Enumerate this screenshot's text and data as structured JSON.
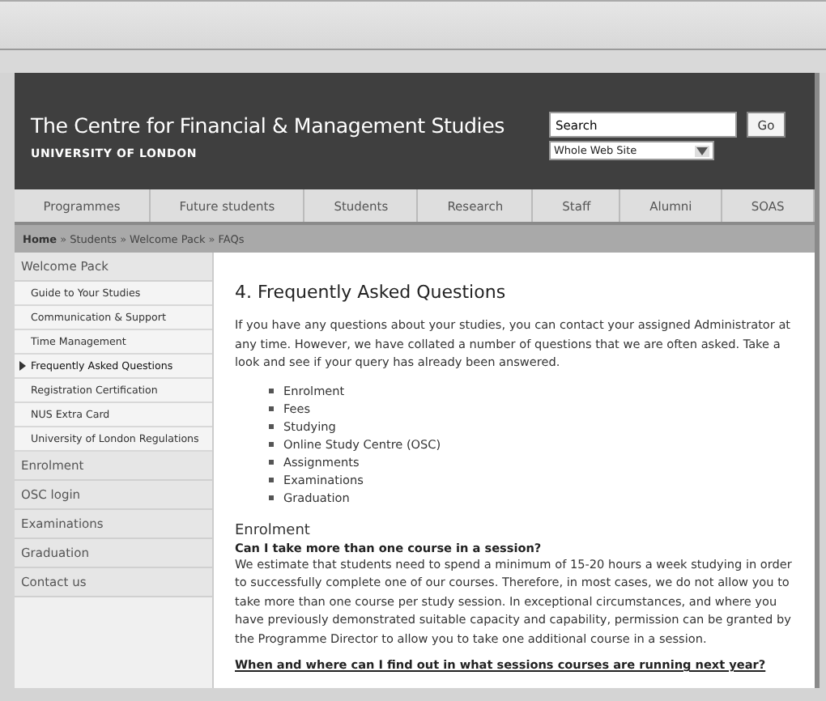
{
  "header": {
    "title": "The Centre for Financial & Management Studies",
    "subtitle": "UNIVERSITY OF LONDON",
    "search": {
      "value": "Search",
      "button": "Go",
      "scope": "Whole Web Site"
    }
  },
  "nav": [
    {
      "label": "Programmes",
      "selected": false
    },
    {
      "label": "Future students",
      "selected": false
    },
    {
      "label": "Students",
      "selected": false
    },
    {
      "label": "Research",
      "selected": false
    },
    {
      "label": "Staff",
      "selected": false
    },
    {
      "label": "Alumni",
      "selected": false
    },
    {
      "label": "SOAS",
      "selected": false
    }
  ],
  "breadcrumb": [
    {
      "label": "Home"
    },
    {
      "label": "Students"
    },
    {
      "label": "Welcome Pack"
    },
    {
      "label": "FAQs"
    }
  ],
  "breadcrumb_separator": "»",
  "sidebar": {
    "items": [
      {
        "label": "Welcome Pack",
        "selected": false,
        "children": [
          {
            "label": "Guide to Your Studies",
            "selected": false
          },
          {
            "label": "Communication & Support",
            "selected": false
          },
          {
            "label": "Time Management",
            "selected": false
          },
          {
            "label": "Frequently Asked Questions",
            "selected": true
          },
          {
            "label": "Registration Certification",
            "selected": false
          },
          {
            "label": "NUS Extra Card",
            "selected": false
          },
          {
            "label": "University of London Regulations",
            "selected": false
          }
        ]
      },
      {
        "label": "Enrolment",
        "selected": false
      },
      {
        "label": "OSC login",
        "selected": false
      },
      {
        "label": "Examinations",
        "selected": false
      },
      {
        "label": "Graduation",
        "selected": false
      },
      {
        "label": "Contact us",
        "selected": false
      }
    ]
  },
  "content": {
    "title": "4. Frequently Asked Questions",
    "intro": "If you have any questions about your studies, you can contact your assigned Administrator at any time. However, we have collated a number of questions that we are often asked. Take a look and see if your query has already been answered.",
    "topics": [
      "Enrolment",
      "Fees",
      "Studying",
      "Online Study Centre (OSC)",
      "Assignments",
      "Examinations",
      "Graduation"
    ],
    "section": "Enrolment",
    "faqs": [
      {
        "question": "Can I take more than one course in a session?",
        "answer": "We estimate that students need to spend a minimum of 15-20 hours a week studying in order to successfully complete one of our courses. Therefore, in most cases, we do not allow you to take more than one course per study session. In exceptional circumstances, and where you have previously demonstrated suitable capacity and capability, permission can be granted by the Programme Director to allow you to take one additional course in a session."
      },
      {
        "question": "When and where can I find out in what sessions courses are running next year?"
      }
    ]
  }
}
